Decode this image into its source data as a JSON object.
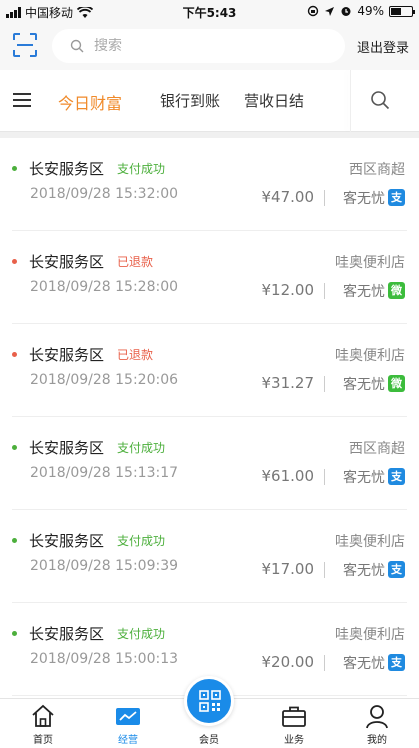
{
  "status_bar": {
    "carrier": "中国移动",
    "time": "下午5:43",
    "battery": "49%",
    "battery_level": 0.49
  },
  "search": {
    "placeholder": "搜索",
    "logout_label": "退出登录"
  },
  "tabs": [
    {
      "label": "今日财富",
      "active": true
    },
    {
      "label": "银行到账",
      "active": false
    },
    {
      "label": "营收日结",
      "active": false
    }
  ],
  "colors": {
    "accent": "#f08a2a",
    "success": "#4caf3c",
    "refund": "#e8604a",
    "primary": "#1a8be8"
  },
  "transactions": [
    {
      "merchant": "长安服务区",
      "status": "支付成功",
      "status_type": "success",
      "store": "西区商超",
      "time": "2018/09/28 15:32:00",
      "amount": "¥47.00",
      "channel": "客无忧",
      "pay_icon": "alipay-icon",
      "pay_glyph": "支"
    },
    {
      "merchant": "长安服务区",
      "status": "已退款",
      "status_type": "refund",
      "store": "哇奥便利店",
      "time": "2018/09/28 15:28:00",
      "amount": "¥12.00",
      "channel": "客无忧",
      "pay_icon": "wechat-icon",
      "pay_glyph": "微"
    },
    {
      "merchant": "长安服务区",
      "status": "已退款",
      "status_type": "refund",
      "store": "哇奥便利店",
      "time": "2018/09/28 15:20:06",
      "amount": "¥31.27",
      "channel": "客无忧",
      "pay_icon": "wechat-icon",
      "pay_glyph": "微"
    },
    {
      "merchant": "长安服务区",
      "status": "支付成功",
      "status_type": "success",
      "store": "西区商超",
      "time": "2018/09/28 15:13:17",
      "amount": "¥61.00",
      "channel": "客无忧",
      "pay_icon": "alipay-icon",
      "pay_glyph": "支"
    },
    {
      "merchant": "长安服务区",
      "status": "支付成功",
      "status_type": "success",
      "store": "哇奥便利店",
      "time": "2018/09/28 15:09:39",
      "amount": "¥17.00",
      "channel": "客无忧",
      "pay_icon": "alipay-icon",
      "pay_glyph": "支"
    },
    {
      "merchant": "长安服务区",
      "status": "支付成功",
      "status_type": "success",
      "store": "哇奥便利店",
      "time": "2018/09/28 15:00:13",
      "amount": "¥20.00",
      "channel": "客无忧",
      "pay_icon": "alipay-icon",
      "pay_glyph": "支"
    }
  ],
  "bottom_nav": [
    {
      "label": "首页",
      "icon": "home-icon",
      "active": false
    },
    {
      "label": "经营",
      "icon": "chart-icon",
      "active": true
    },
    {
      "label": "会员",
      "icon": "qrcode-icon",
      "active": false
    },
    {
      "label": "业务",
      "icon": "briefcase-icon",
      "active": false
    },
    {
      "label": "我的",
      "icon": "user-icon",
      "active": false
    }
  ]
}
